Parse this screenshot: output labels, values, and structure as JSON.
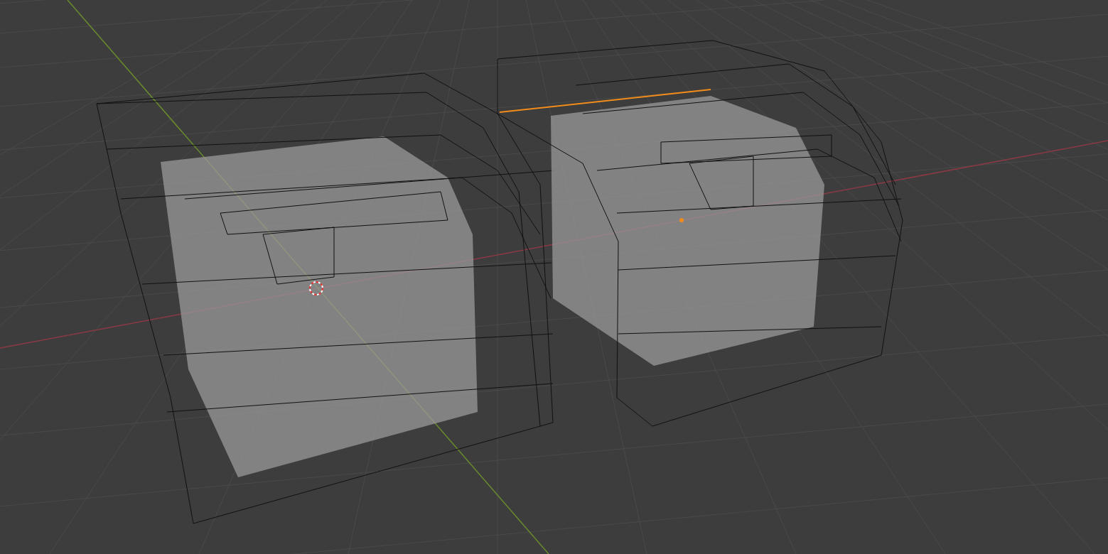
{
  "objects": [
    {
      "selected": false
    },
    {
      "selected": true
    }
  ]
}
